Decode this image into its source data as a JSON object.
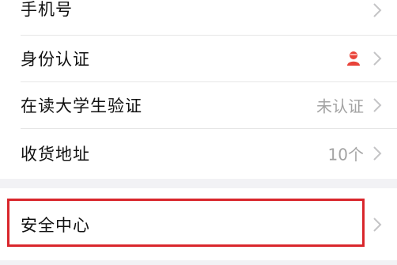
{
  "settings": {
    "rows": [
      {
        "label": "手机号",
        "value": ""
      },
      {
        "label": "身份认证",
        "value": "",
        "icon": "person-id-icon",
        "icon_color": "#e8433a"
      },
      {
        "label": "在读大学生验证",
        "value": "未认证"
      },
      {
        "label": "收货地址",
        "value": "10个"
      }
    ],
    "security": {
      "label": "安全中心"
    }
  },
  "colors": {
    "highlight": "#d9262c",
    "chevron": "#c4c4c6",
    "value_text": "#a3a3a3",
    "background": "#f2f2f5"
  }
}
